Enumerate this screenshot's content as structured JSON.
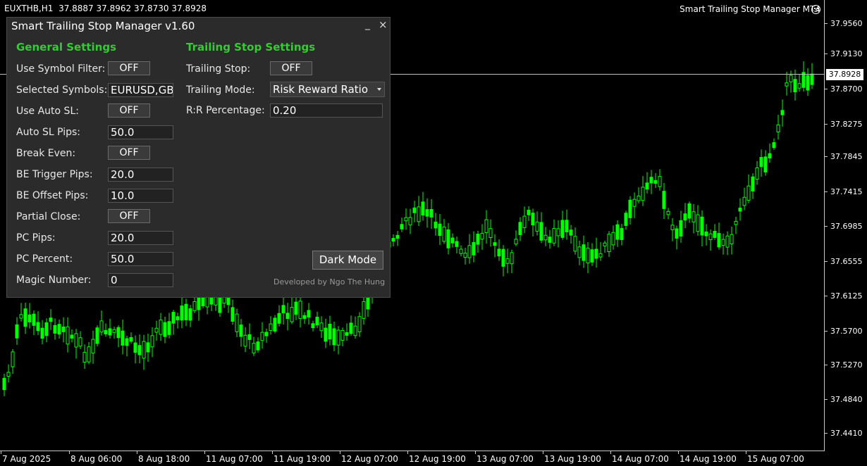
{
  "chart": {
    "symbol_info": "EUXTHB,H1  37.8887 37.8962 37.8730 37.8928",
    "ea_label": "Smart Trailing Stop Manager MT4",
    "current_price": "37.8928",
    "price_axis": [
      "37.9560",
      "37.9130",
      "37.8700",
      "37.8275",
      "37.7845",
      "37.7415",
      "37.6985",
      "37.6555",
      "37.6125",
      "37.5700",
      "37.5270",
      "37.4840",
      "37.4410"
    ],
    "time_axis": [
      "7 Aug 2025",
      "8 Aug 06:00",
      "8 Aug 18:00",
      "11 Aug 07:00",
      "11 Aug 19:00",
      "12 Aug 07:00",
      "12 Aug 19:00",
      "13 Aug 07:00",
      "13 Aug 19:00",
      "14 Aug 07:00",
      "14 Aug 19:00",
      "15 Aug 07:00"
    ],
    "colors": {
      "background": "#000000",
      "candle": "#00ff00",
      "axis": "#c8c8c8"
    }
  },
  "panel": {
    "title": "Smart Trailing Stop Manager v1.60",
    "minimize": "_",
    "close": "×",
    "general_title": "General Settings",
    "trailing_title": "Trailing Stop Settings",
    "general": [
      {
        "label": "Use Symbol Filter:",
        "kind": "toggle",
        "value": "OFF"
      },
      {
        "label": "Selected Symbols:",
        "kind": "input",
        "value": "EURUSD,GB"
      },
      {
        "label": "Use Auto SL:",
        "kind": "toggle",
        "value": "OFF"
      },
      {
        "label": "Auto SL Pips:",
        "kind": "input",
        "value": "50.0"
      },
      {
        "label": "Break Even:",
        "kind": "toggle",
        "value": "OFF"
      },
      {
        "label": "BE Trigger Pips:",
        "kind": "input",
        "value": "20.0"
      },
      {
        "label": "BE Offset Pips:",
        "kind": "input",
        "value": "10.0"
      },
      {
        "label": "Partial Close:",
        "kind": "toggle",
        "value": "OFF"
      },
      {
        "label": "PC Pips:",
        "kind": "input",
        "value": "20.0"
      },
      {
        "label": "PC Percent:",
        "kind": "input",
        "value": "50.0"
      },
      {
        "label": "Magic Number:",
        "kind": "input",
        "value": "0"
      }
    ],
    "trailing": {
      "trailing_stop_label": "Trailing Stop:",
      "trailing_stop_value": "OFF",
      "mode_label": "Trailing Mode:",
      "mode_value": "Risk Reward Ratio",
      "rr_label": "R:R Percentage:",
      "rr_value": "0.20"
    },
    "dark_mode_button": "Dark Mode",
    "credit": "Developed by Ngo The Hung",
    "accent_color": "#32cd32"
  }
}
